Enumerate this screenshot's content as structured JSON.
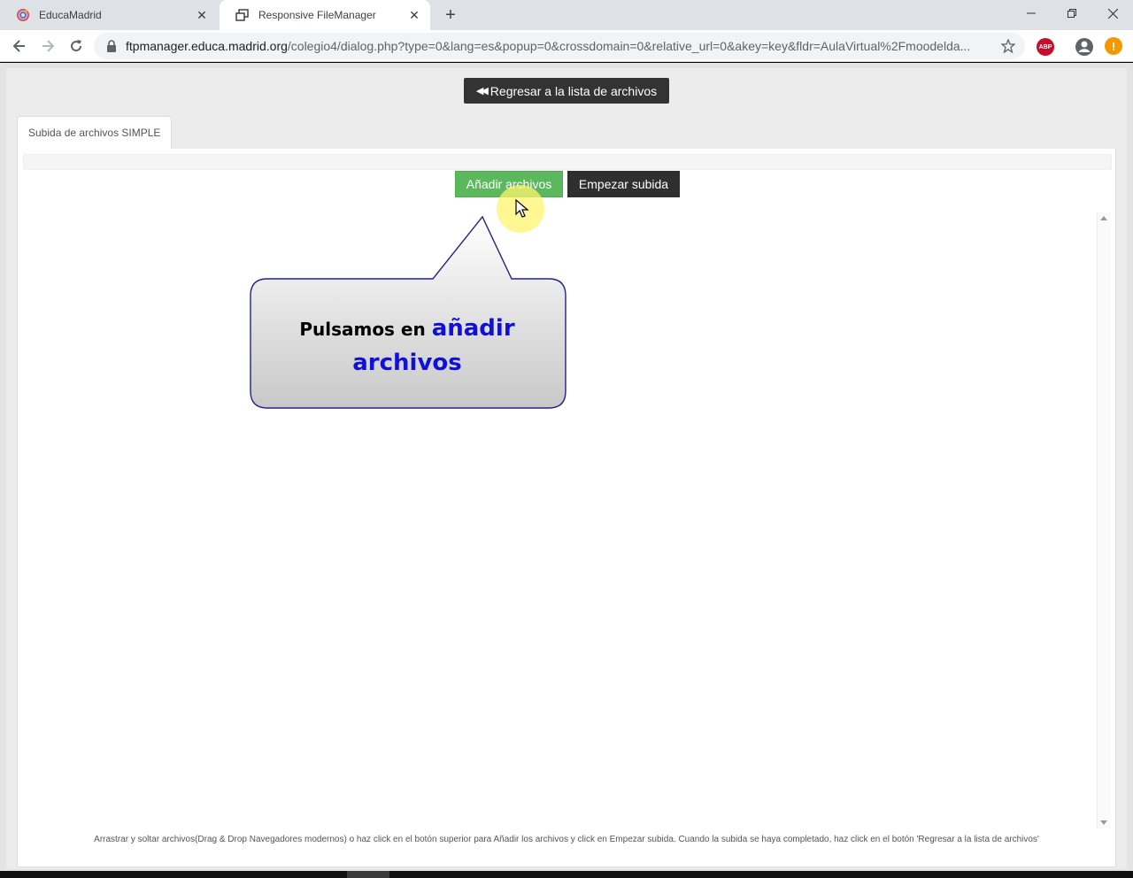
{
  "browser": {
    "tabs": [
      {
        "title": "EducaMadrid",
        "active": false
      },
      {
        "title": "Responsive FileManager",
        "active": true
      }
    ],
    "address": {
      "host": "ftpmanager.educa.madrid.org",
      "path": "/colegio4/dialog.php?type=0&lang=es&popup=0&crossdomain=0&relative_url=0&akey=key&fldr=AulaVirtual%2Fmoodelda..."
    },
    "extension_label": "ABP",
    "update_badge": "!"
  },
  "filemanager": {
    "back_button": "Regresar a la lista de archivos",
    "upload_tab": "Subida de archivos SIMPLE",
    "add_files_button": "Añadir archivos",
    "start_upload_button": "Empezar subida",
    "help_text": "Arrastrar y soltar archivos(Drag & Drop Navegadores modernos) o haz click en el botón superior para Añadir los archivos y click en Empezar subida. Cuando la subida se haya completado, haz click en el botón 'Regresar a la lista de archivos'"
  },
  "callout": {
    "lead": "Pulsamos en",
    "highlight": "añadir archivos"
  },
  "colors": {
    "add_button": "#5cb85c",
    "dark_button": "#333333",
    "callout_highlight": "#1010d6",
    "cursor_halo": "#fff56e"
  }
}
